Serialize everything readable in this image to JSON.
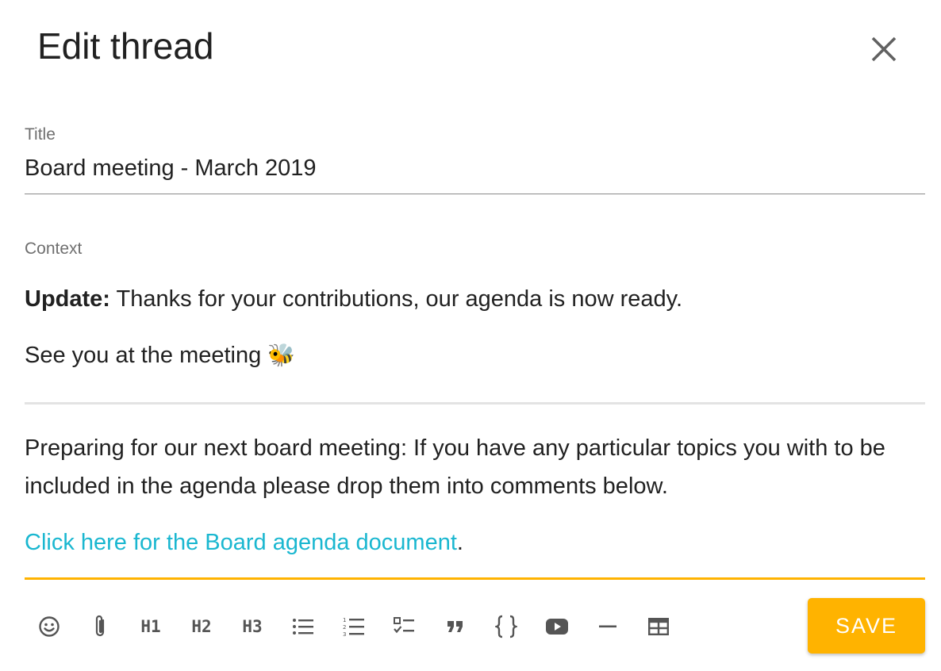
{
  "dialog": {
    "title": "Edit thread",
    "close_icon": "close-icon"
  },
  "title_field": {
    "label": "Title",
    "value": "Board meeting - March 2019"
  },
  "context_field": {
    "label": "Context",
    "update_bold": "Update:",
    "update_text": " Thanks for your contributions, our agenda is now ready.",
    "see_you_text": "See you at the meeting ",
    "bee_emoji": "🐝",
    "preparing_text": "Preparing for our next board meeting: If you have any particular topics you with to be included in the agenda please drop them into comments below.",
    "link_text": "Click here for the Board agenda document",
    "link_suffix": "."
  },
  "toolbar": {
    "h1_label": "H1",
    "h2_label": "H2",
    "h3_label": "H3",
    "icons": [
      "emoji-icon",
      "attachment-icon",
      "heading-1",
      "heading-2",
      "heading-3",
      "bulleted-list-icon",
      "numbered-list-icon",
      "checklist-icon",
      "quote-icon",
      "code-icon",
      "video-icon",
      "horizontal-rule-icon",
      "table-icon"
    ]
  },
  "save_button": {
    "label": "SAVE"
  },
  "colors": {
    "accent": "#ffb300",
    "link": "#1ab7d0"
  }
}
